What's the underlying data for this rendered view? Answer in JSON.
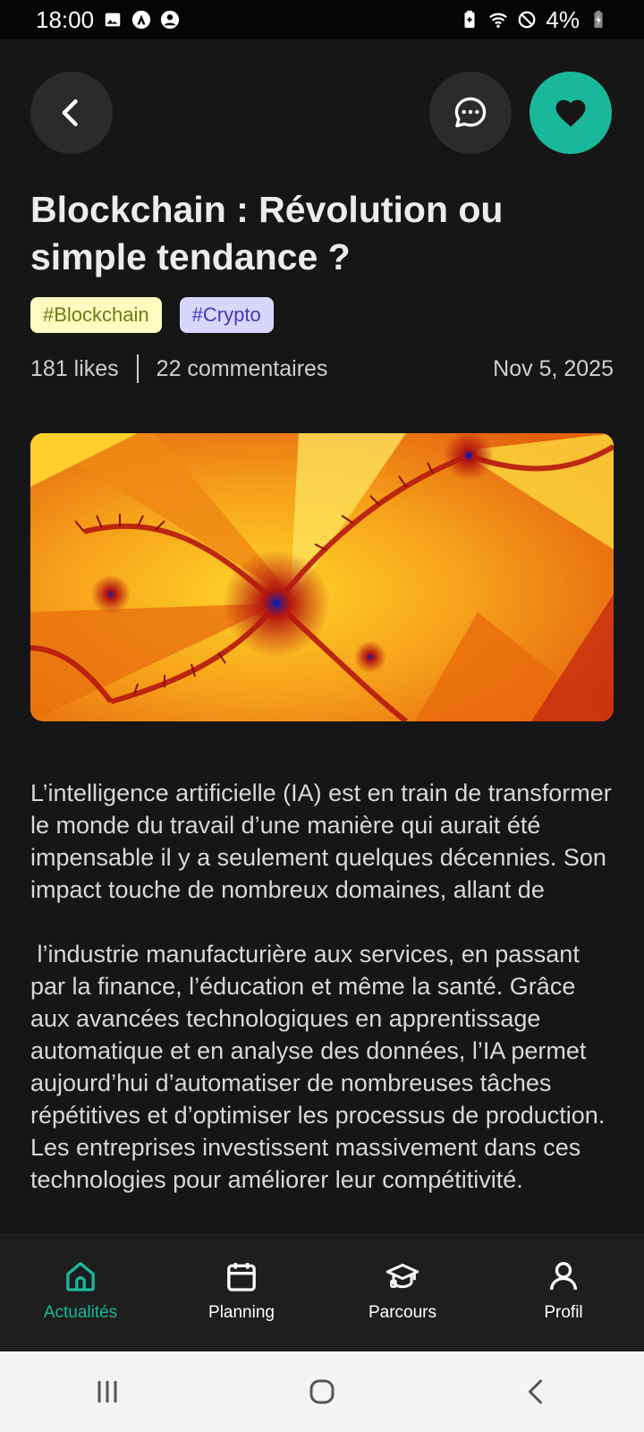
{
  "status_bar": {
    "time": "18:00",
    "battery": "4%"
  },
  "article": {
    "title": "Blockchain : Révolution ou simple tendance ?",
    "tags": [
      {
        "label": "#Blockchain",
        "bg": "#fdfbbf",
        "fg": "#6b7d18"
      },
      {
        "label": "#Crypto",
        "bg": "#d9d6fb",
        "fg": "#4737b8"
      }
    ],
    "likes": "181 likes",
    "comments": "22 commentaires",
    "date": "Nov 5, 2025",
    "paragraphs": [
      "L’intelligence artificielle (IA) est en train de transformer le monde du travail d’une manière qui aurait été impensable il y a seulement quelques décennies. Son impact touche de nombreux domaines, allant de",
      " l’industrie manufacturière aux services, en passant par la finance, l’éducation et même la santé. Grâce aux avancées technologiques en apprentissage automatique et en analyse des données, l’IA permet aujourd’hui d’automatiser de nombreuses tâches répétitives et d’optimiser les processus de production. Les entreprises investissent massivement dans ces technologies pour améliorer leur compétitivité."
    ]
  },
  "nav": {
    "items": [
      {
        "label": "Actualités",
        "icon": "home-icon",
        "active": true
      },
      {
        "label": "Planning",
        "icon": "calendar-icon",
        "active": false
      },
      {
        "label": "Parcours",
        "icon": "graduation-cap-icon",
        "active": false
      },
      {
        "label": "Profil",
        "icon": "user-icon",
        "active": false
      }
    ]
  },
  "colors": {
    "accent": "#1ab89b",
    "background": "#161616",
    "nav_background": "#1e1e1e"
  }
}
